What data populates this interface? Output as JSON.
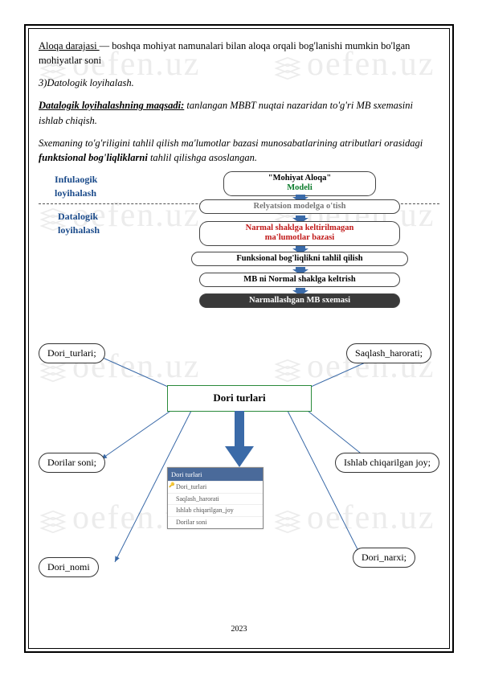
{
  "watermark_text": "oefen.uz",
  "text": {
    "p1a": "Aloqa darajasi ",
    "p1b": "— boshqa mohiyat namunalari bilan aloqa orqali bog'lanishi mumkin bo'lgan mohiyatlar soni",
    "p2": "3)Datologik loyihalash.",
    "p3a": "Datalogik loyihalashning maqsadi:",
    "p3b": " tanlangan MBBT nuqtai nazaridan to'g'ri MB sxemasini ishlab chiqish.",
    "p4a": "Sxemaning to'g'riligini tahlil qilish ma'lumotlar bazasi munosabatlarining atributlari orasidagi ",
    "p4b": "funktsional bog'liqliklarni",
    "p4c": " tahlil qilishga asoslangan."
  },
  "diagram1": {
    "left1": "Infulaogik loyihalash",
    "left2": "Datalogik loyihalash",
    "box1a": "\"Mohiyat Aloqa\"",
    "box1b": "Modeli",
    "box2": "Relyatsion modelga o'tish",
    "box3a": "Narmal shaklga keltirilmagan",
    "box3b": "ma'lumotlar bazasi",
    "box4": "Funksional bog'liqlikni tahlil qilish",
    "box5": "MB ni Normal shaklga keltrish",
    "box6": "Narmallashgan MB sxemasi"
  },
  "diagram2": {
    "pill_tl": "Dori_turlari;",
    "pill_tr": "Saqlash_harorati;",
    "pill_bl": "Dorilar soni;",
    "pill_br": "Ishlab chiqarilgan joy;",
    "pill_bbl": "Dori_nomi",
    "pill_bbr": "Dori_narxi;",
    "entity": "Dori turlari",
    "table_hdr": "Dori turlari",
    "table_rows": [
      "Dori_turlari",
      "Saqlash_harorati",
      "Ishlab chiqarilgan_joy",
      "Dorilar soni"
    ]
  },
  "footer_year": "2023"
}
